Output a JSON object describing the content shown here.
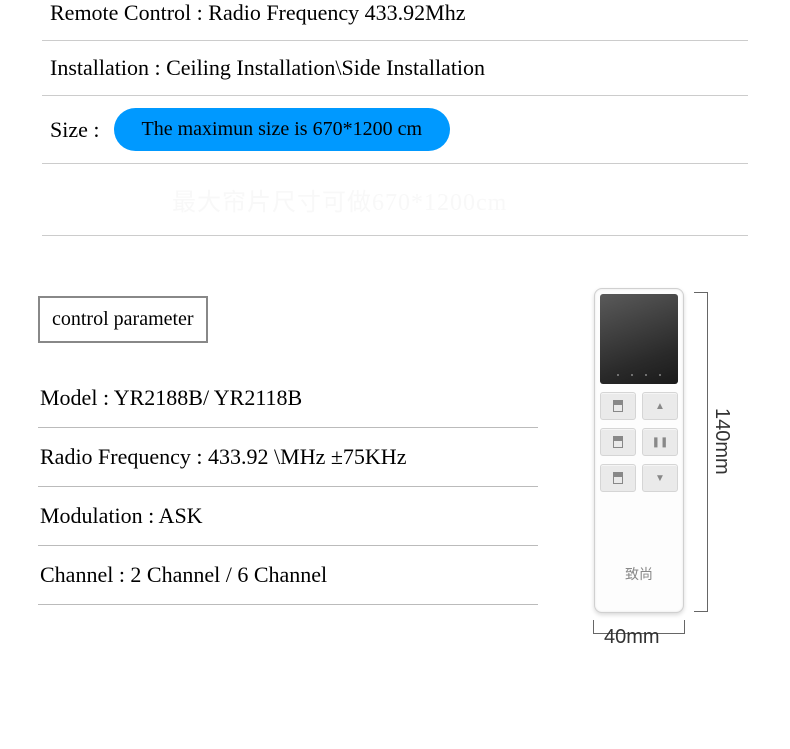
{
  "top_specs": {
    "remote_control": "Remote Control : Radio Frequency 433.92Mhz",
    "installation": "Installation : Ceiling Installation\\Side Installation",
    "size_label": "Size :",
    "size_value": "The maximun size is 670*1200 cm",
    "ghost": "最大帘片尺寸可做670*1200cm"
  },
  "control_parameter": {
    "header": "control parameter",
    "model": "Model : YR2188B/ YR2118B",
    "radio_frequency": "Radio Frequency : 433.92 \\MHz ±75KHz",
    "modulation": "Modulation : ASK",
    "channel": "Channel : 2 Channel / 6 Channel"
  },
  "remote": {
    "logo": "致尚",
    "height_label": "140mm",
    "width_label": "40mm",
    "buttons": {
      "up": "▲",
      "pause": "❚❚",
      "down": "▼"
    }
  }
}
